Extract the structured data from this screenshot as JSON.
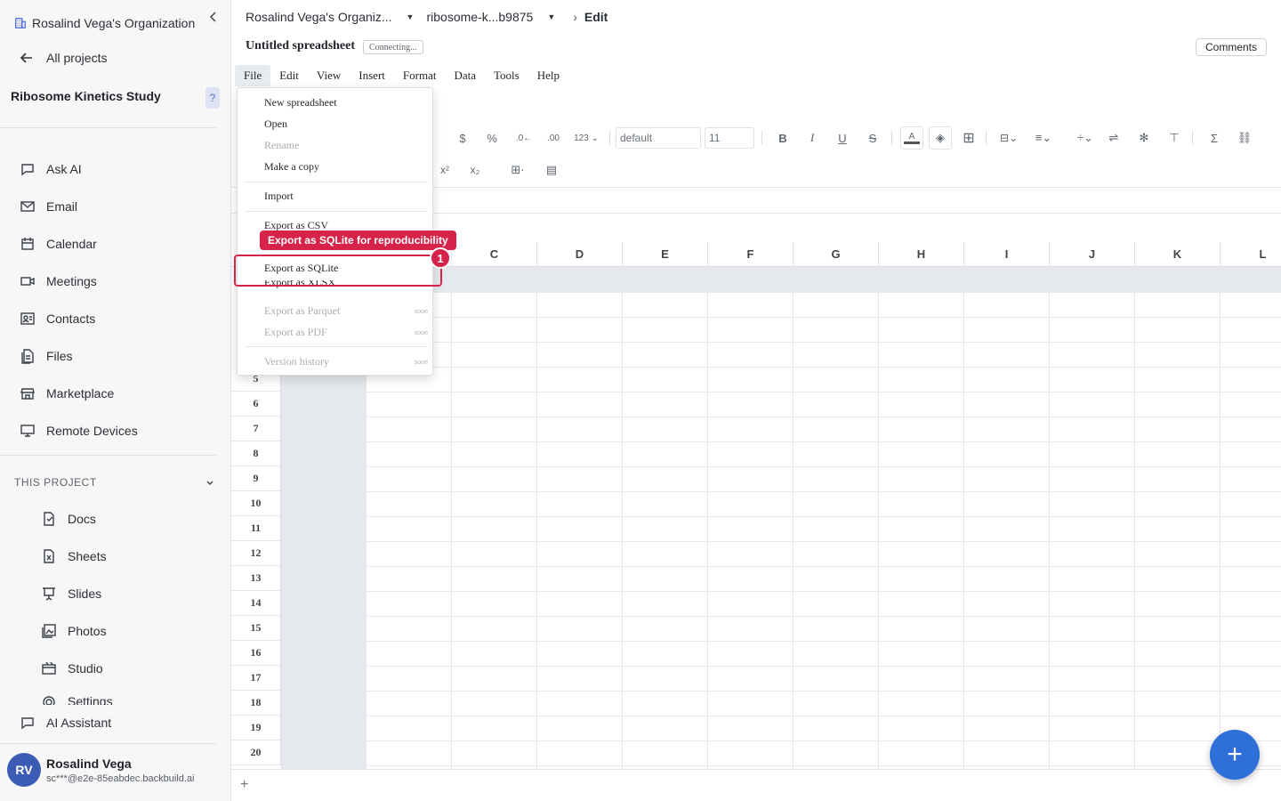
{
  "sidebar": {
    "org_name": "Rosalind Vega's Organization",
    "all_projects": "All projects",
    "project_title": "Ribosome Kinetics Study",
    "help": "?",
    "nav": [
      {
        "label": "Ask AI",
        "icon": "chat-icon"
      },
      {
        "label": "Email",
        "icon": "mail-icon"
      },
      {
        "label": "Calendar",
        "icon": "calendar-icon"
      },
      {
        "label": "Meetings",
        "icon": "video-icon"
      },
      {
        "label": "Contacts",
        "icon": "contacts-icon"
      },
      {
        "label": "Files",
        "icon": "files-icon"
      },
      {
        "label": "Marketplace",
        "icon": "store-icon"
      },
      {
        "label": "Remote Devices",
        "icon": "monitor-icon"
      }
    ],
    "section_title": "THIS PROJECT",
    "project_items": [
      {
        "label": "Docs",
        "icon": "doc-icon"
      },
      {
        "label": "Sheets",
        "icon": "sheet-icon"
      },
      {
        "label": "Slides",
        "icon": "slides-icon"
      },
      {
        "label": "Photos",
        "icon": "photo-icon"
      },
      {
        "label": "Studio",
        "icon": "studio-icon"
      },
      {
        "label": "Settings",
        "icon": "gear-icon"
      }
    ],
    "ai_assistant": "AI Assistant",
    "user": {
      "initials": "RV",
      "name": "Rosalind Vega",
      "email": "sc***@e2e-85eabdec.backbuild.ai"
    }
  },
  "header": {
    "breadcrumb": [
      "Rosalind Vega's Organiz...",
      "ribosome-k...b9875",
      "Edit"
    ],
    "doc_title": "Untitled spreadsheet",
    "status": "Connecting...",
    "comments": "Comments"
  },
  "menubar": [
    "File",
    "Edit",
    "View",
    "Insert",
    "Format",
    "Data",
    "Tools",
    "Help"
  ],
  "toolbar": {
    "font": "default",
    "font_size": "11",
    "number_format": "123"
  },
  "file_menu": {
    "items": [
      {
        "label": "New spreadsheet",
        "disabled": false
      },
      {
        "label": "Open",
        "disabled": false
      },
      {
        "label": "Rename",
        "disabled": true
      },
      {
        "label": "Make a copy",
        "disabled": false
      },
      {
        "label": "Import",
        "disabled": false
      },
      {
        "label": "Export as CSV",
        "disabled": false
      },
      {
        "label": "Export as SQLite",
        "disabled": false
      },
      {
        "label": "Export as XLSX",
        "disabled": false
      },
      {
        "label": "Export as Parquet",
        "disabled": true,
        "tag": "soon"
      },
      {
        "label": "Export as PDF",
        "disabled": true,
        "tag": "soon"
      },
      {
        "label": "Version history",
        "disabled": true,
        "tag": "soon"
      }
    ]
  },
  "annotation": {
    "tooltip": "Export as SQLite for reproducibility",
    "badge": "1"
  },
  "grid": {
    "columns": [
      "C",
      "D",
      "E",
      "F",
      "G",
      "H",
      "I",
      "J",
      "K",
      "L"
    ],
    "rows": [
      "5",
      "6",
      "7",
      "8",
      "9",
      "10",
      "11",
      "12",
      "13",
      "14",
      "15",
      "16",
      "17",
      "18",
      "19",
      "20"
    ]
  },
  "colors": {
    "accent": "#2f6fd8",
    "annotation": "#d7234a"
  }
}
